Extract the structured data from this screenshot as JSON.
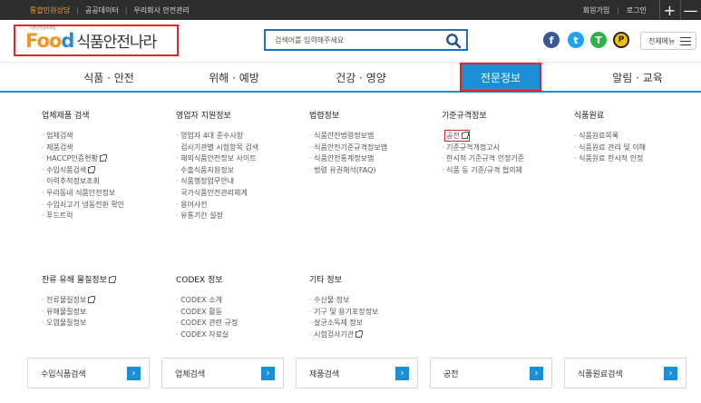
{
  "topbar": {
    "left": [
      "통합민원상담",
      "공공데이터",
      "우리회사 안전관리"
    ],
    "right": [
      "회원가입",
      "로그인"
    ],
    "plus": "+",
    "minus": "—"
  },
  "logo": {
    "tagline": "식품안전정보포털",
    "brand_f": "F",
    "brand_oo": "oo",
    "brand_d": "d",
    "korean": "식품안전나라"
  },
  "search": {
    "placeholder": "검색어를 입력해주세요"
  },
  "social": {
    "facebook": "f",
    "twitter": "t",
    "kakaotalk": "T",
    "kakaostory": "P"
  },
  "all_menu": "전체메뉴",
  "nav": [
    "식품 · 안전",
    "위해 · 예방",
    "건강 · 영양",
    "전문정보",
    "알림 · 교육"
  ],
  "menu": {
    "c1": {
      "title": "업체제품 검색",
      "items": [
        "업체검색",
        "제품검색",
        "HACCP인증현황",
        "수입식품검색",
        "이력추적정보조회",
        "우리동네 식품안전정보",
        "수입쇠고기 냉동전환 확인",
        "푸드트럭"
      ]
    },
    "c2": {
      "title": "영업자 지원정보",
      "items": [
        "영업자 4대 준수사항",
        "검사기관별 시험항목 검색",
        "해외식품안전정보 사이트",
        "수출식품지원정보",
        "식품행정업무안내",
        "국가식품안전관리체계",
        "용어사전",
        "유통기간 설정"
      ]
    },
    "c3": {
      "title": "법령정보",
      "items": [
        "식품안전법령정보맵",
        "식품안전기준규격정보맵",
        "식품안전통계정보맵",
        "법령 유권해석(FAQ)"
      ]
    },
    "c4": {
      "title": "기준규격정보",
      "items": [
        "공전",
        "기준규격개정고시",
        "한시적 기준규격 인정기준",
        "식품 등 기준/규격 협의체"
      ]
    },
    "c5": {
      "title": "식품원료",
      "items": [
        "식품원료목록",
        "식품원료 관리 및 이해",
        "식품원료 한시적 인정"
      ]
    },
    "c6": {
      "title": "잔류 유해 물질정보",
      "items": [
        "잔류물질정보",
        "유해물질정보",
        "오염물질정보"
      ]
    },
    "c7": {
      "title": "CODEX 정보",
      "items": [
        "CODEX 소개",
        "CODEX 활동",
        "CODEX 관련 규정",
        "CODEX 자료실"
      ]
    },
    "c8": {
      "title": "기타 정보",
      "items": [
        "수산물 정보",
        "기구 및 용기포장정보",
        "살균소독제 정보",
        "시험검사기관"
      ]
    }
  },
  "quick": [
    "수입식품검색",
    "업체검색",
    "제품검색",
    "공전",
    "식품원료검색"
  ],
  "quick_arrow": "›"
}
